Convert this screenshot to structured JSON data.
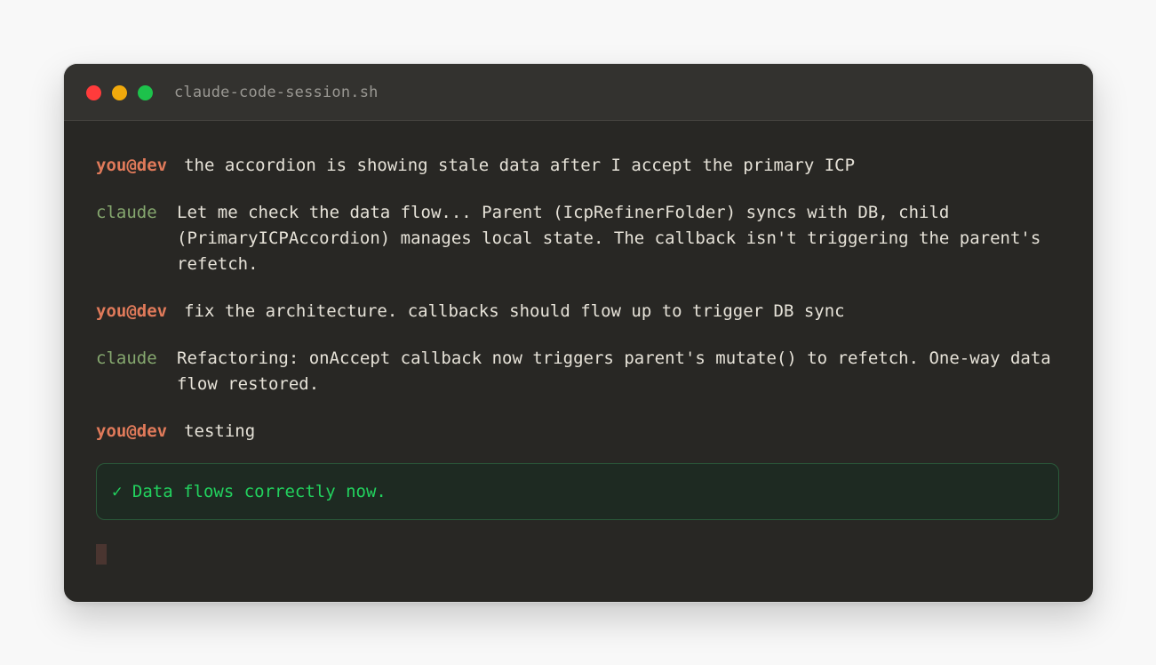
{
  "window": {
    "title": "claude-code-session.sh"
  },
  "session": {
    "user_prompt": "you@dev",
    "assistant_prompt": "claude",
    "messages": [
      {
        "role": "user",
        "text": "the accordion is showing stale data after I accept the primary ICP"
      },
      {
        "role": "assistant",
        "text": "Let me check the data flow... Parent (IcpRefinerFolder) syncs with DB, child (PrimaryICPAccordion) manages local state. The callback isn't triggering the parent's refetch."
      },
      {
        "role": "user",
        "text": "fix the architecture. callbacks should flow up to trigger DB sync"
      },
      {
        "role": "assistant",
        "text": "Refactoring: onAccept callback now triggers parent's mutate() to refetch. One-way data flow restored."
      },
      {
        "role": "user",
        "text": "testing"
      }
    ],
    "result": "✓ Data flows correctly now."
  },
  "colors": {
    "user_prompt": "#e07a5a",
    "assistant_prompt": "#86a86f",
    "success": "#22d25e",
    "terminal_bg": "#282724",
    "titlebar_bg": "#33322f"
  },
  "icons": {
    "close": "red-dot",
    "minimize": "yellow-dot",
    "maximize": "green-dot",
    "check": "check-icon"
  }
}
